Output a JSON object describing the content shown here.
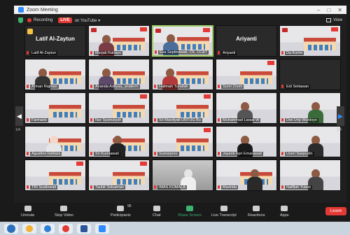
{
  "window": {
    "title": "Zoom Meeting"
  },
  "topbar": {
    "recording": "Recording",
    "live": "LIVE",
    "youtube": "on YouTube ▾",
    "view": "View"
  },
  "participants": [
    {
      "name": "Latif Al-Zaytun"
    },
    {
      "name": "Marjati Rahayu"
    },
    {
      "name": "Eva Septinawati, CK, CC&T"
    },
    {
      "name": "Ariyanti"
    },
    {
      "name": "Da Kurtm"
    },
    {
      "name": "Arman Rajman"
    },
    {
      "name": "Ananda Adityaa_anaterm"
    },
    {
      "name": "Halimah Tunafah"
    },
    {
      "name": "Sunri Zoom"
    },
    {
      "name": "Edi Setiawan"
    },
    {
      "name": "Farmaris"
    },
    {
      "name": "Nur Syamsiyah"
    },
    {
      "name": "Sri Mardiyati UNTUG Bu"
    },
    {
      "name": "Muhammad Larasi W"
    },
    {
      "name": "Dwi Urip Wardoyo"
    },
    {
      "name": "Agustine Indriani"
    },
    {
      "name": "Sri Kurniawati"
    },
    {
      "name": "Sumarjono"
    },
    {
      "name": "Jayanti Apri Emarawati"
    },
    {
      "name": "Uzeri Saepudin"
    },
    {
      "name": "TRI Susilowati"
    },
    {
      "name": "Tauhit Soluaman"
    },
    {
      "name": "IMAS KOMALA"
    },
    {
      "name": "Martrida"
    },
    {
      "name": "Naflilah Yulani"
    }
  ],
  "big_labels": {
    "tile1": "Latif Al-Zaytun",
    "tile4": "Ariyanti"
  },
  "pages": {
    "left": "1/4",
    "right": "1/4"
  },
  "toolbar": {
    "unmute": "Unmute",
    "stop_video": "Stop Video",
    "participants": "Participants",
    "participants_count": "96",
    "chat": "Chat",
    "share": "Share Screen",
    "transcript": "Live Transcript",
    "reactions": "Reactions",
    "apps": "Apps",
    "leave": "Leave"
  }
}
